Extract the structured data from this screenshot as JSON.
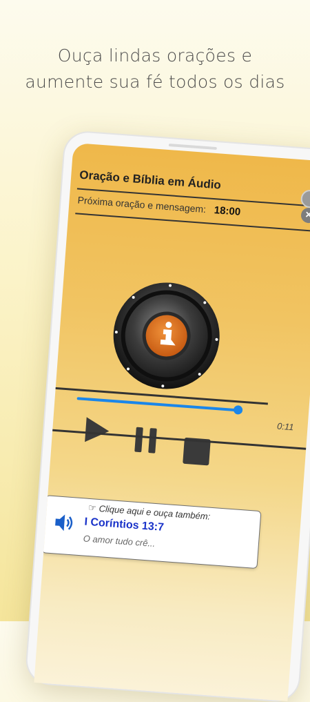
{
  "headline": {
    "line1": "Ouça lindas orações e",
    "line2": "aumente sua fé todos os dias"
  },
  "app": {
    "title": "Oração e Bíblia em Áudio",
    "next_label": "Próxima oração e mensagem:",
    "next_time": "18:00"
  },
  "player": {
    "elapsed": "0:11",
    "progress": 0.95,
    "speaker_icon": "praying-person-icon"
  },
  "card": {
    "hint": "Clique aqui e ouça também:",
    "verse": "I Coríntios 13:7",
    "snippet": "O amor tudo crê..."
  },
  "colors": {
    "accent_blue": "#1a86ea",
    "verse_blue": "#1a33c9",
    "speaker_orange": "#e07020",
    "header_gold": "#efb84a"
  }
}
